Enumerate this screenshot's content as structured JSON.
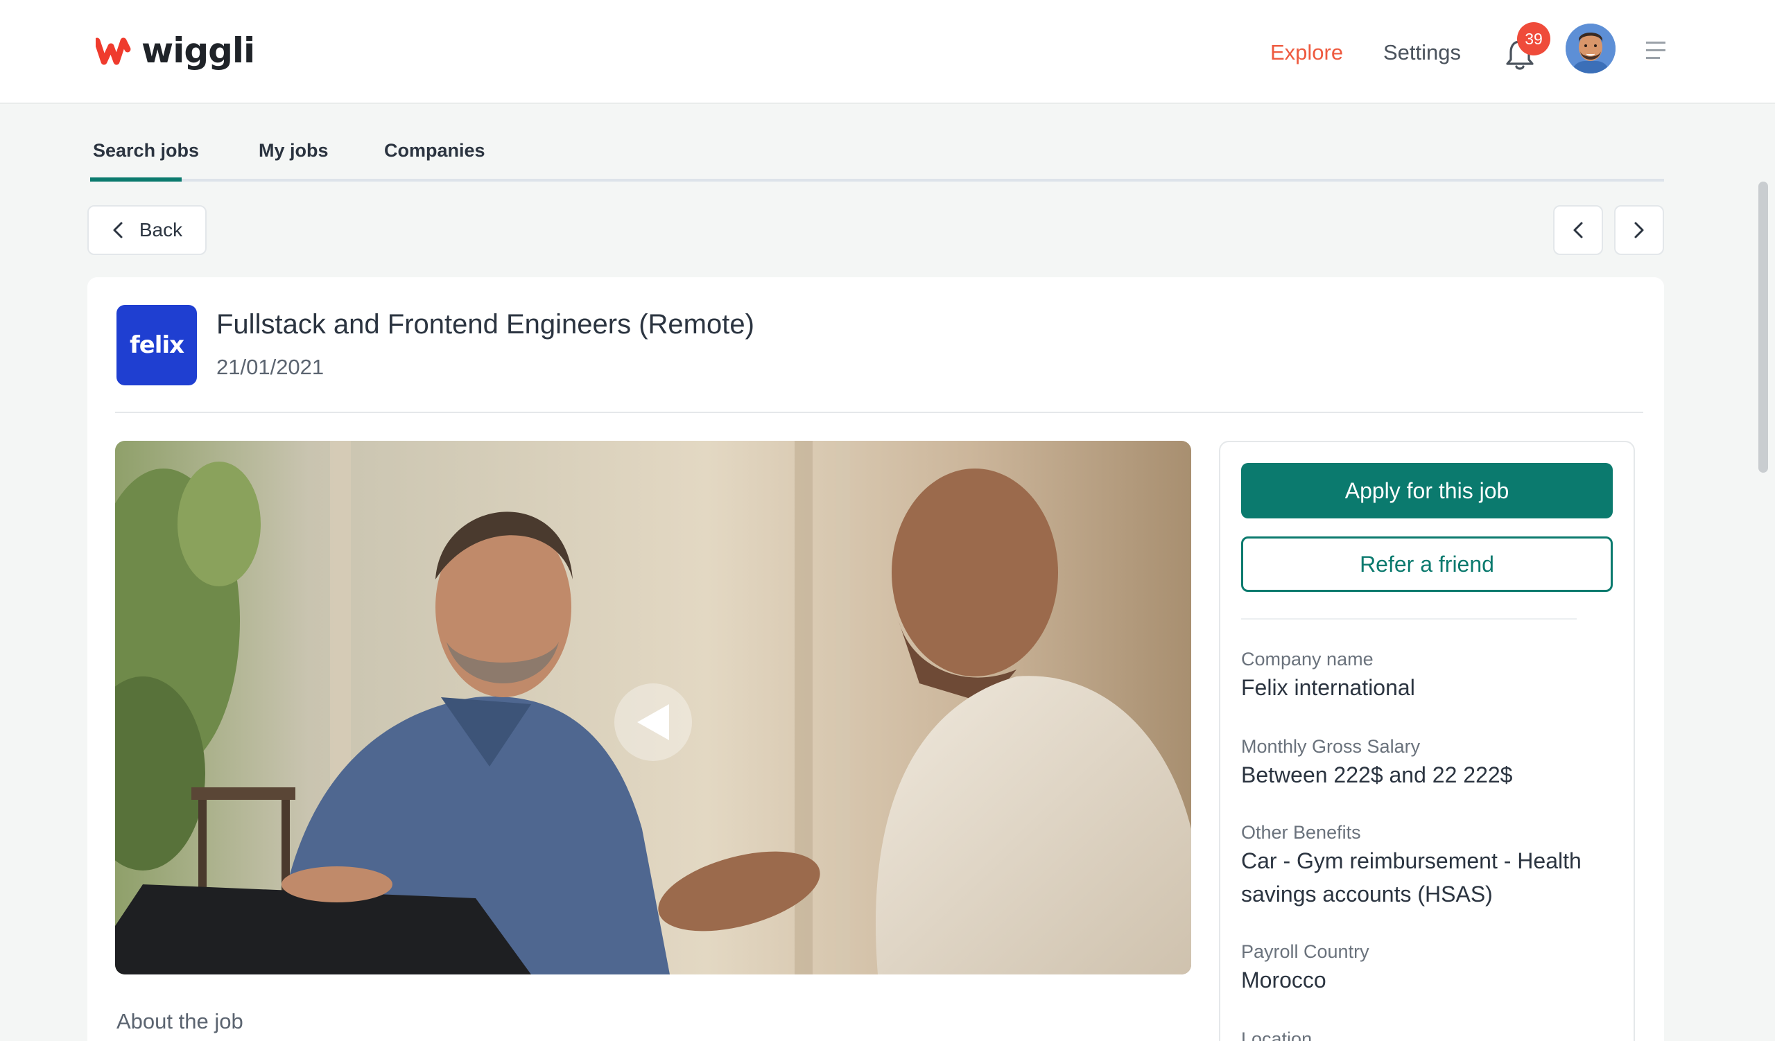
{
  "brand": {
    "name": "wiggli",
    "accent": "#ee5a3f",
    "primary": "#0b7a6e"
  },
  "header": {
    "explore_label": "Explore",
    "settings_label": "Settings",
    "notification_count": "39",
    "icons": [
      "bell-icon",
      "avatar",
      "menu-icon"
    ]
  },
  "tabs": [
    {
      "label": "Search jobs",
      "active": true
    },
    {
      "label": "My jobs",
      "active": false
    },
    {
      "label": "Companies",
      "active": false
    }
  ],
  "toolbar": {
    "back_label": "Back"
  },
  "job": {
    "company_logo_text": "felix",
    "title": "Fullstack and Frontend Engineers (Remote)",
    "date": "21/01/2021",
    "about_label": "About the job"
  },
  "sidebar": {
    "apply_label": "Apply for this job",
    "refer_label": "Refer a friend",
    "fields": [
      {
        "label": "Company name",
        "value": "Felix international"
      },
      {
        "label": "Monthly Gross Salary",
        "value": "Between 222$ and 22 222$"
      },
      {
        "label": "Other Benefits",
        "value": "Car - Gym reimbursement - Health savings accounts (HSAS)"
      },
      {
        "label": "Payroll Country",
        "value": "Morocco"
      },
      {
        "label": "Location",
        "value": ""
      }
    ]
  }
}
